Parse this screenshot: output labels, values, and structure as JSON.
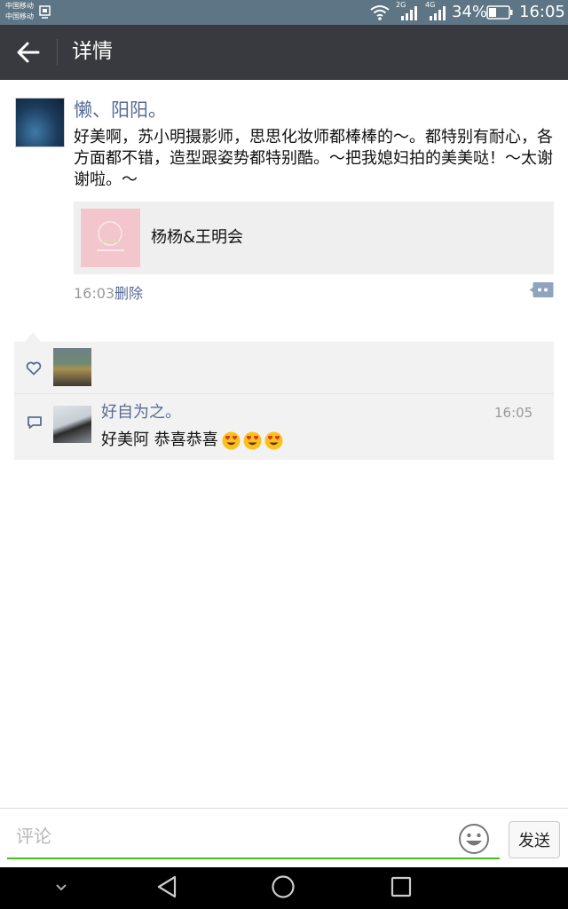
{
  "status_bar": {
    "carrier_1": "中国移动",
    "carrier_2": "中国移动",
    "net_1": "2G",
    "net_2": "4G",
    "battery": "34%",
    "time": "16:05"
  },
  "header": {
    "title": "详情",
    "back_icon": "arrow-left-icon"
  },
  "post": {
    "author": "懒、阳阳。",
    "text": "好美啊，苏小明摄影师，思思化妆师都棒棒的～。都特别有耐心，各方面都不错，造型跟姿势都特别酷。～把我媳妇拍的美美哒！～太谢谢啦。～",
    "share": {
      "title": "杨杨&王明会"
    },
    "time": "16:03",
    "delete_label": "删除",
    "comment_icon": "comment-dots-icon"
  },
  "interactions": {
    "like_icon": "heart-icon",
    "comment_icon": "speech-bubble-icon",
    "comments": [
      {
        "name": "好自为之。",
        "time": "16:05",
        "text": "好美阿 恭喜恭喜",
        "emoji_count": 3
      }
    ]
  },
  "input_bar": {
    "placeholder": "评论",
    "send_label": "发送",
    "emoji_icon": "smiley-icon"
  },
  "nav_bar": {
    "icons": [
      "chevron-down-icon",
      "triangle-back-icon",
      "circle-home-icon",
      "square-recents-icon"
    ]
  },
  "colors": {
    "status_bar": "#5d7584",
    "title_bar": "#393a3f",
    "link": "#576b95",
    "accent_green": "#45c01a",
    "panel": "#f2f2f2"
  }
}
